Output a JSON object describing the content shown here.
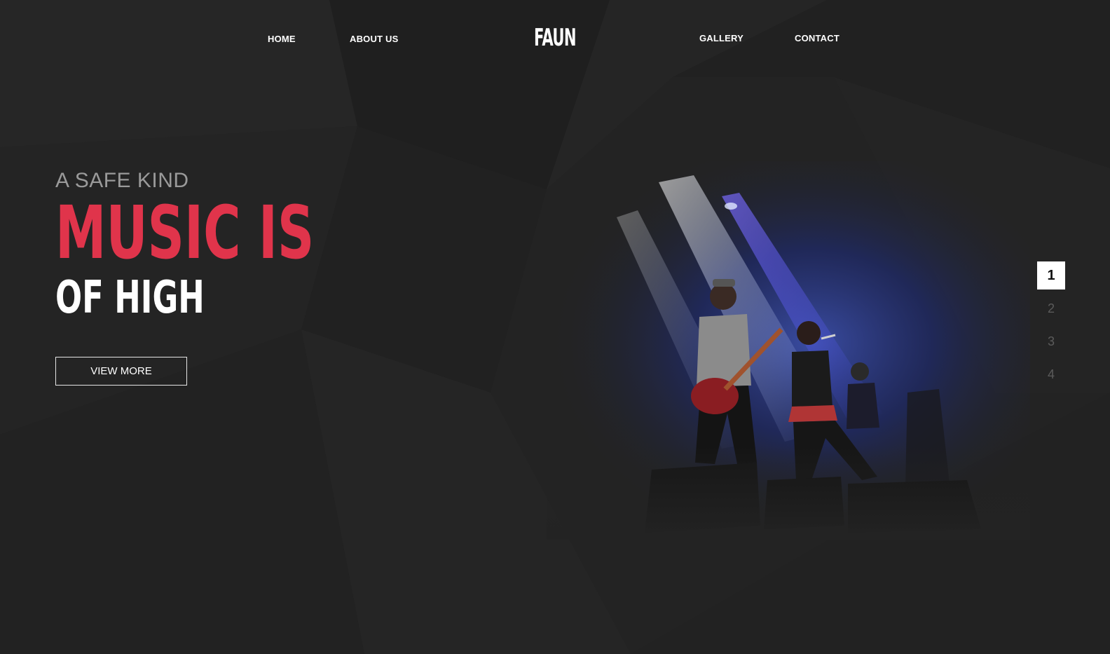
{
  "nav": {
    "left": [
      "HOME",
      "ABOUT US"
    ],
    "logo": "FAUN",
    "right": [
      "GALLERY",
      "CONTACT"
    ]
  },
  "hero": {
    "kicker": "A SAFE KIND",
    "headline_red": "MUSIC IS",
    "headline_white": "OF HIGH",
    "button_label": "VIEW MORE",
    "image_description": "band performing on stage under blue and white spotlights"
  },
  "pager": {
    "pages": [
      "1",
      "2",
      "3",
      "4"
    ],
    "active": "1"
  },
  "colors": {
    "background": "#232323",
    "accent_red": "#e0344b",
    "text_white": "#ffffff",
    "text_gray": "#9a9a9a",
    "pager_inactive": "#5b5b5b"
  }
}
